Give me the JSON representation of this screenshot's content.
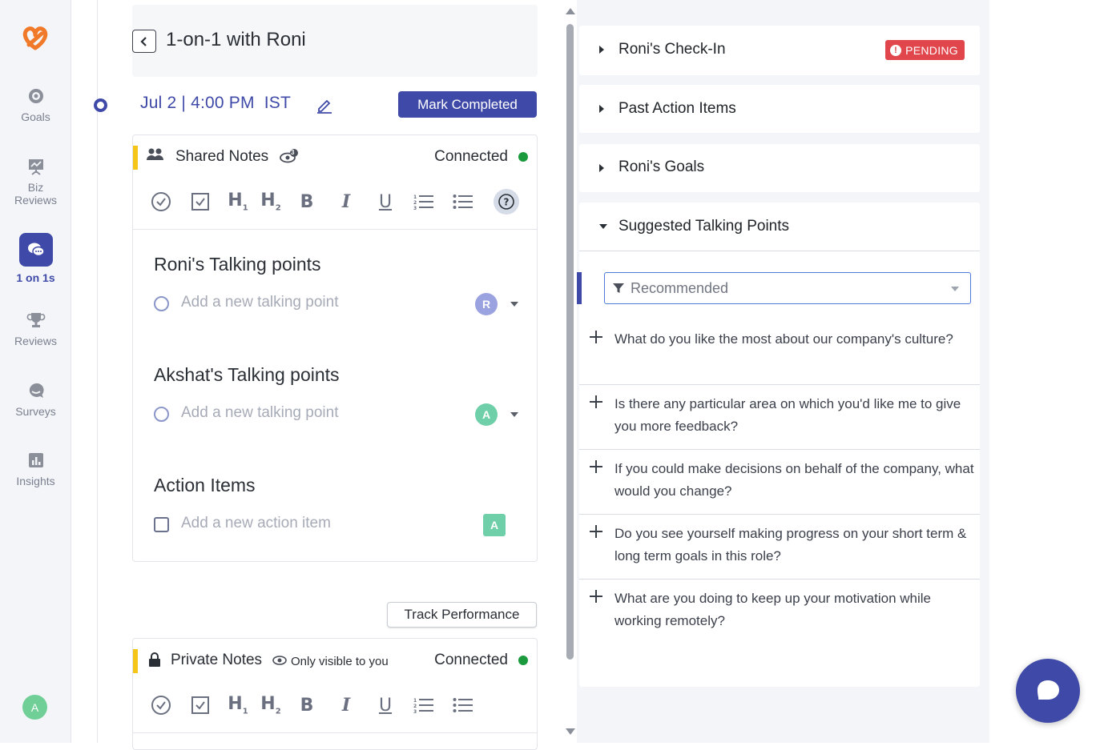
{
  "app": {
    "brand_color": "#f07a2a",
    "accent": "#3f4aa8"
  },
  "sidebar": {
    "items": [
      {
        "label": "Goals",
        "icon": "target-icon"
      },
      {
        "label": "Biz Reviews",
        "icon": "presentation-icon"
      },
      {
        "label": "1 on 1s",
        "icon": "chat-bubbles-icon",
        "active": true
      },
      {
        "label": "Reviews",
        "icon": "trophy-icon"
      },
      {
        "label": "Surveys",
        "icon": "speech-bubble-icon"
      },
      {
        "label": "Insights",
        "icon": "bar-chart-icon"
      }
    ],
    "user_initial": "A"
  },
  "header": {
    "title": "1-on-1 with Roni"
  },
  "meeting": {
    "datetime": "Jul 2 | 4:00 PM  IST",
    "mark_completed": "Mark Completed"
  },
  "shared_notes": {
    "title": "Shared Notes",
    "status": "Connected",
    "viewers_count": "3",
    "sections": [
      {
        "title": "Roni's Talking points",
        "placeholder": "Add a new talking point",
        "avatar": "R",
        "avatar_color": "#9ba2e0"
      },
      {
        "title": "Akshat's Talking points",
        "placeholder": "Add a new talking point",
        "avatar": "A",
        "avatar_color": "#6fcfa8"
      },
      {
        "title": "Action Items",
        "placeholder": "Add a new action item",
        "avatar": "A",
        "avatar_color": "#6fcfa8"
      }
    ]
  },
  "track_performance": "Track Performance",
  "private_notes": {
    "title": "Private Notes",
    "visibility": "Only visible to you",
    "status": "Connected"
  },
  "right_panel": {
    "accordions": [
      {
        "label": "Roni's Check-In",
        "badge": "PENDING",
        "expanded": false
      },
      {
        "label": "Past Action Items",
        "expanded": false
      },
      {
        "label": "Roni's Goals",
        "expanded": false
      },
      {
        "label": "Suggested Talking Points",
        "expanded": true
      }
    ],
    "filter": {
      "selected": "Recommended"
    },
    "questions": [
      "What do you like the most about our company's culture?",
      "Is there any particular area on which you'd like me to give you more feedback?",
      "If you could make decisions on behalf of the company, what would you change?",
      "Do you see yourself making progress on your short term & long term goals in this role?",
      "What are you doing to keep up your motivation while working remotely?"
    ]
  }
}
